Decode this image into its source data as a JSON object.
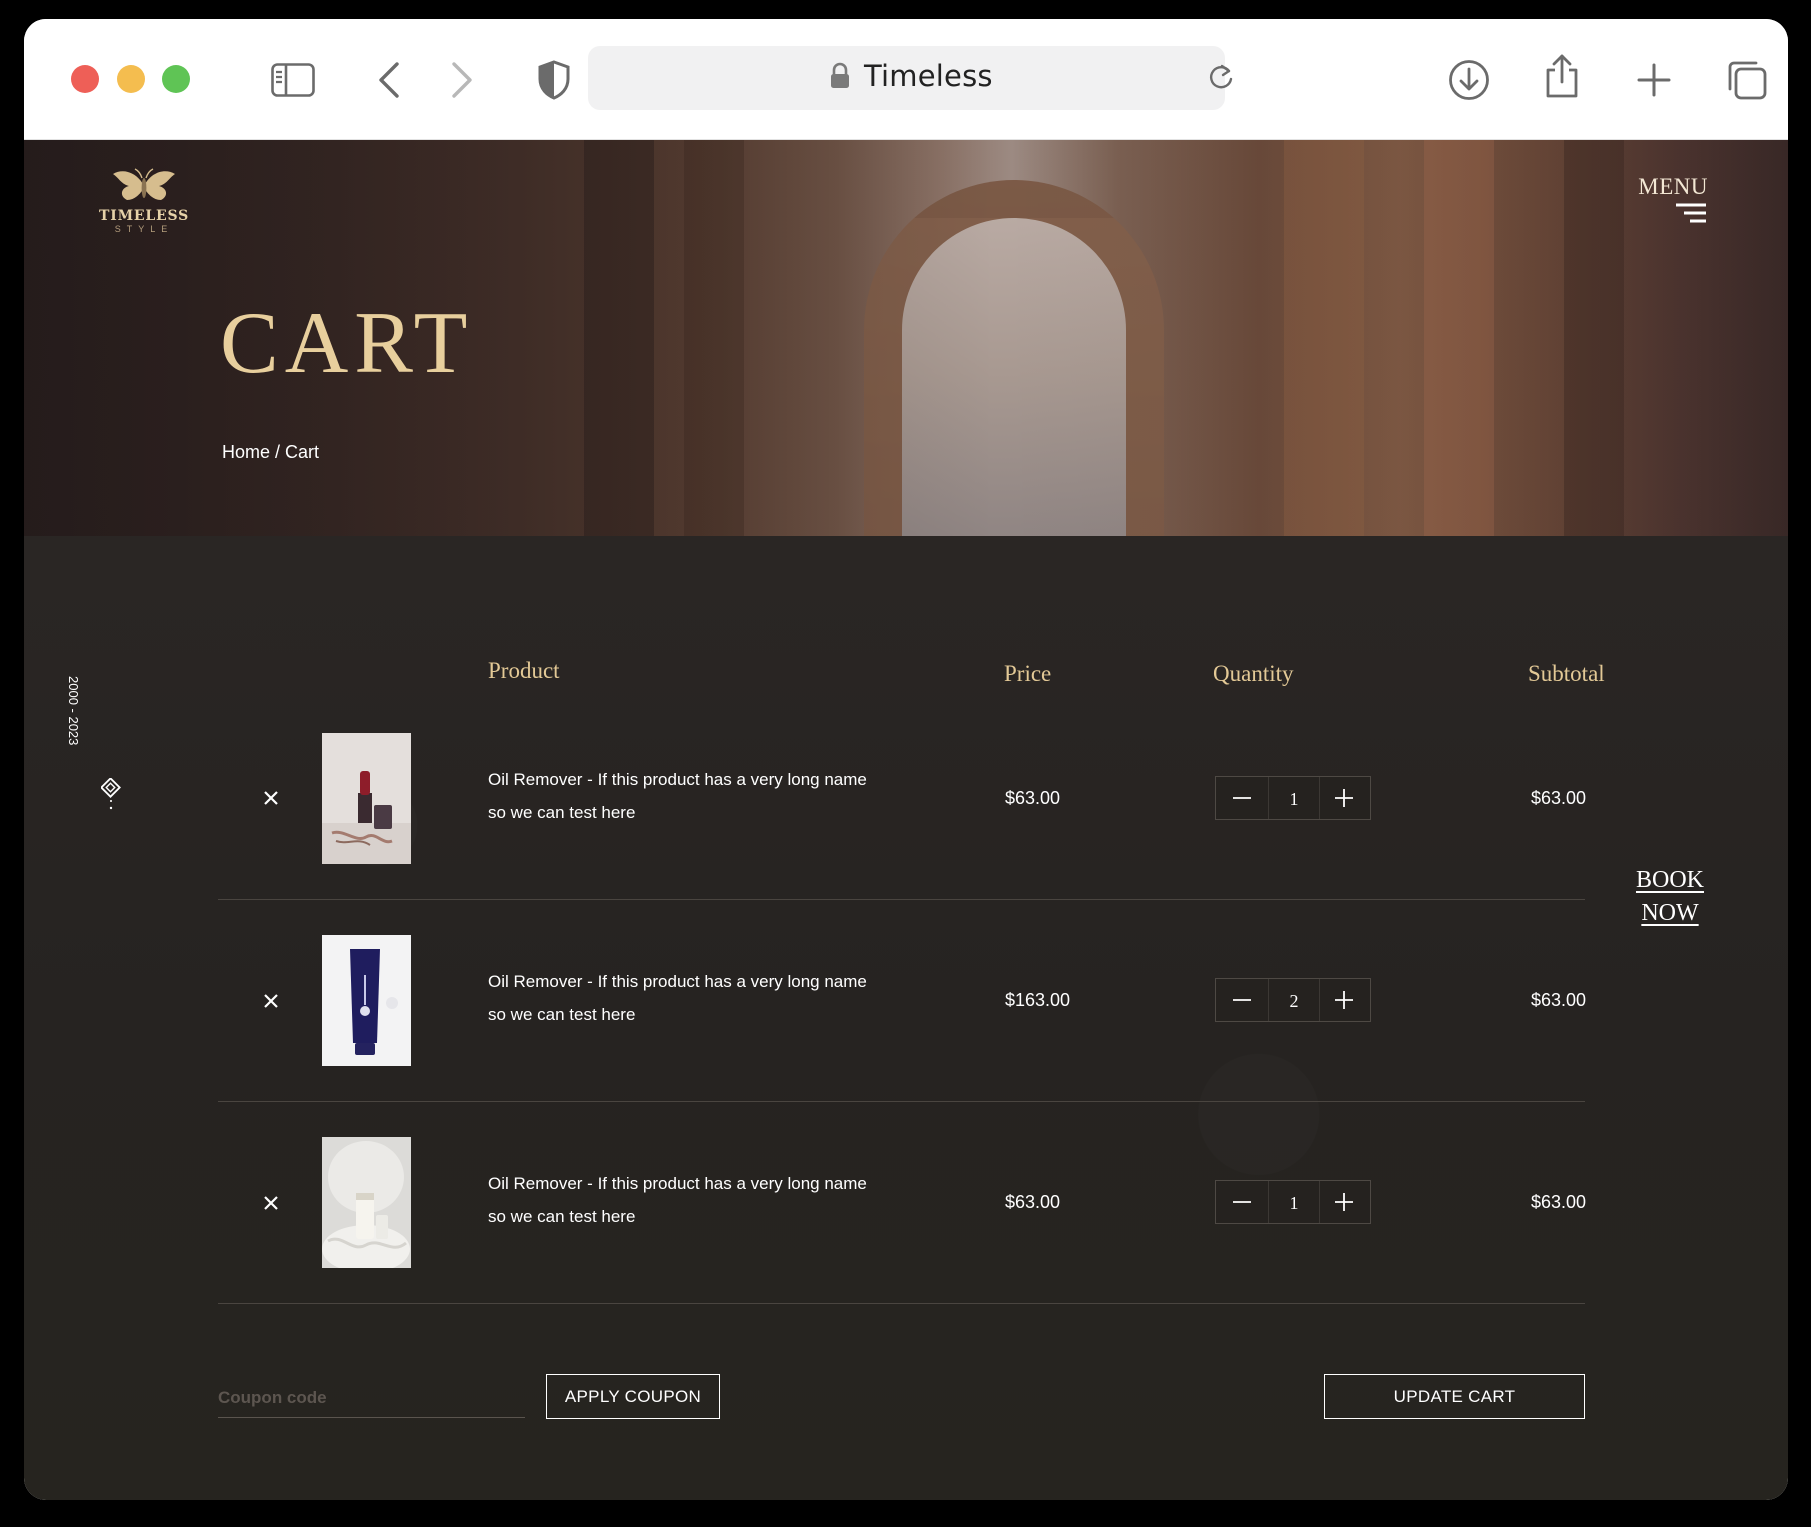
{
  "browser": {
    "url_title": "Timeless",
    "icons": [
      "sidebar-icon",
      "back-icon",
      "forward-icon",
      "shield-icon",
      "lock-icon",
      "reload-icon",
      "download-icon",
      "share-icon",
      "new-tab-icon",
      "tabs-overview-icon"
    ]
  },
  "site": {
    "logo_name": "TIMELESS",
    "logo_sub": "STYLE",
    "menu_label": "MENU"
  },
  "hero": {
    "title": "CART",
    "breadcrumb": "Home / Cart"
  },
  "side": {
    "years": "2000 - 2023",
    "book_now_line1": "BOOK",
    "book_now_line2": "NOW"
  },
  "table": {
    "headers": {
      "product": "Product",
      "price": "Price",
      "quantity": "Quantity",
      "subtotal": "Subtotal"
    },
    "rows": [
      {
        "name_line1": "Oil Remover - If this product has a very long name",
        "name_line2": "so we can test here",
        "price": "$63.00",
        "quantity": "1",
        "subtotal": "$63.00",
        "image": "lipstick-product-photo"
      },
      {
        "name_line1": "Oil Remover - If this product has a very long name",
        "name_line2": "so we can test here",
        "price": "$163.00",
        "quantity": "2",
        "subtotal": "$63.00",
        "image": "blue-tube-product-photo"
      },
      {
        "name_line1": "Oil Remover - If this product has a very long name",
        "name_line2": "so we can test here",
        "price": "$63.00",
        "quantity": "1",
        "subtotal": "$63.00",
        "image": "cream-product-photo"
      }
    ]
  },
  "actions": {
    "coupon_placeholder": "Coupon code",
    "apply_coupon": "APPLY COUPON",
    "update_cart": "UPDATE CART"
  },
  "colors": {
    "accent_gold": "#e3c996",
    "title_gold": "#e8cf9d",
    "background": "#26231f"
  }
}
